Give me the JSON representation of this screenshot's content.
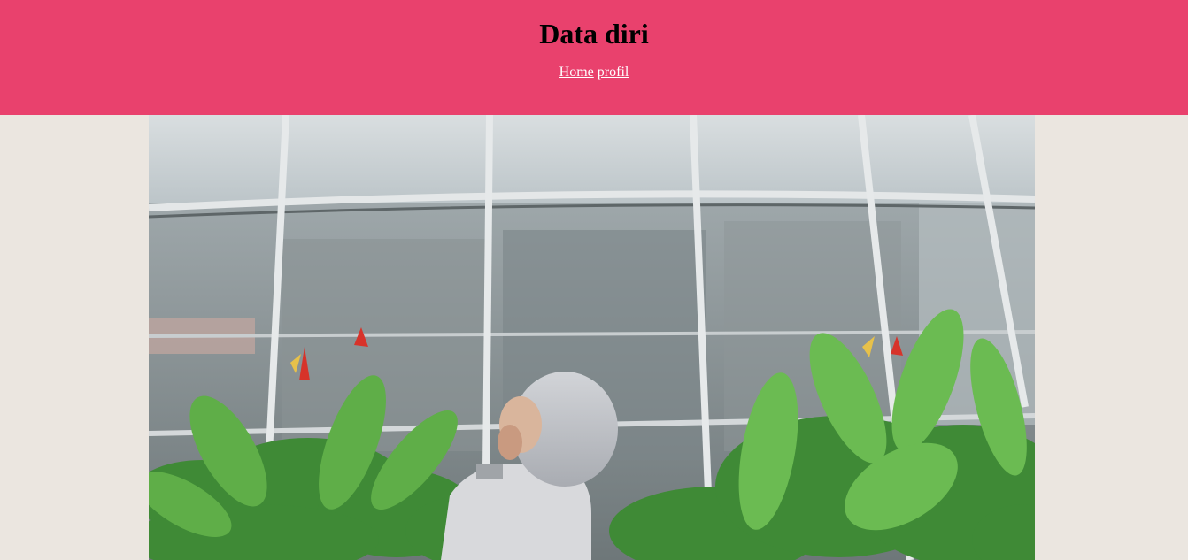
{
  "header": {
    "title": "Data diri",
    "background_color": "#e9416d"
  },
  "nav": {
    "links": [
      {
        "label": "Home"
      },
      {
        "label": "profil"
      }
    ]
  },
  "photo": {
    "icon": "photo-image",
    "description_visible": false
  }
}
